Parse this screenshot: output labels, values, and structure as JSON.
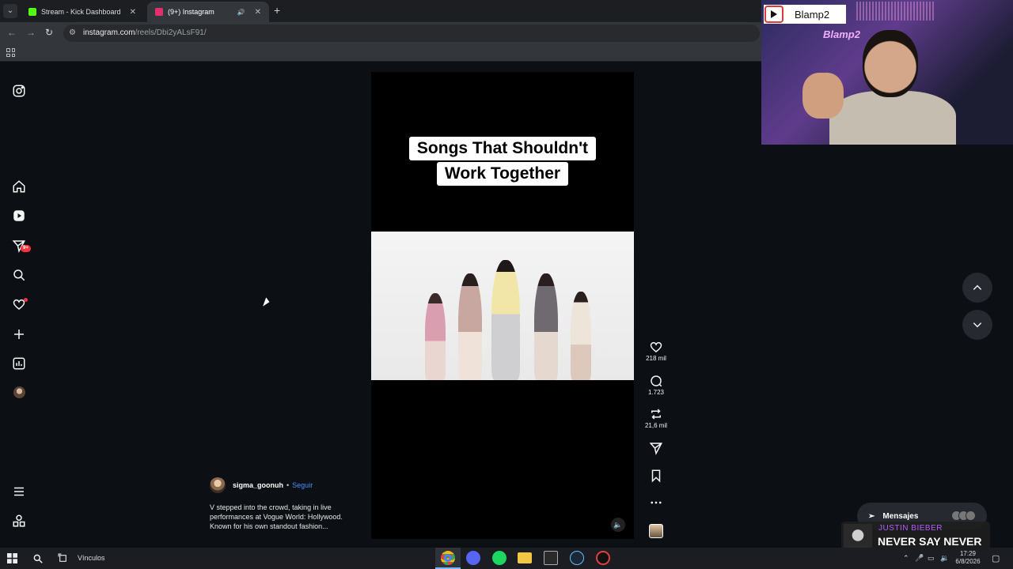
{
  "browser": {
    "tabs": [
      {
        "label": "Stream - Kick Dashboard",
        "favicon_color": "#53fc18"
      },
      {
        "label": "(9+) Instagram",
        "favicon_color": "#e1306c"
      }
    ],
    "url_host": "instagram.com",
    "url_path": "/reels/Dbi2yALsF91/"
  },
  "reel": {
    "caption_line1": "Songs That Shouldn't",
    "caption_line2": "Work Together",
    "likes": "218 mil",
    "comments": "1.723",
    "reposts": "21,6 mil",
    "author": "sigma_goonuh",
    "separator": "•",
    "follow_label": "Seguir",
    "description": "V stepped into the crowd, taking in live performances at Vogue World: Hollywood. Known for his own standout fashion..."
  },
  "sidebar": {
    "notifications_badge": "9+"
  },
  "messages": {
    "label": "Mensajes"
  },
  "webcam": {
    "channel_name": "Blamp2",
    "neon_sign": "Blamp2"
  },
  "now_playing": {
    "artist": "JUSTIN BIEBER",
    "song": "NEVER SAY NEVER"
  },
  "taskbar": {
    "links_label": "Vínculos",
    "time": "17:29",
    "date": "6/8/2026"
  },
  "colors": {
    "accent_blue": "#4a90ff",
    "notification_red": "#ff3040",
    "background": "#0c0f13"
  }
}
